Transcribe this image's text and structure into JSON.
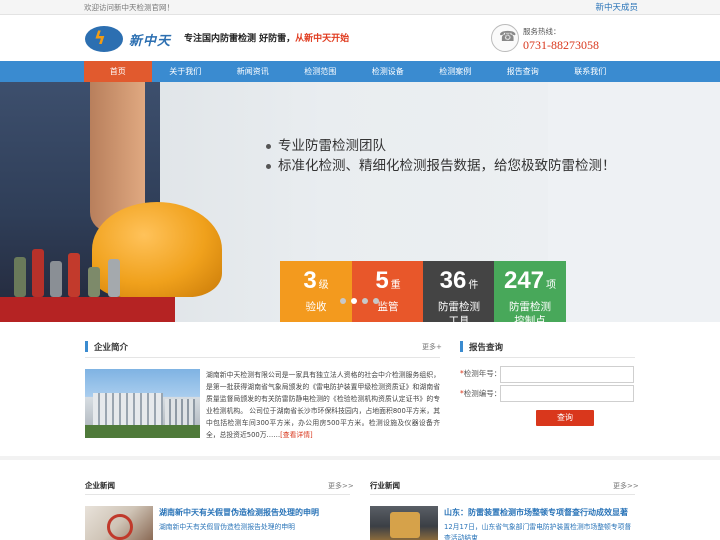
{
  "topbar": {
    "welcome": "欢迎访问新中天检测官网！",
    "member": "新中天成员"
  },
  "header": {
    "logo_text": "新中天",
    "slogan_main": "专注国内防雷检测 好防雷，",
    "slogan_red": "从新中天开始",
    "hotline_label": "服务热线：",
    "hotline_number": "0731-88273058"
  },
  "nav": {
    "items": [
      "首页",
      "关于我们",
      "新闻资讯",
      "检测范围",
      "检测设备",
      "检测案例",
      "报告查询",
      "联系我们"
    ],
    "active_index": 0
  },
  "banner": {
    "bullets": [
      "专业防雷检测团队",
      "标准化检测、精细化检测报告数据，给您极致防雷检测！"
    ],
    "stats": [
      {
        "number": "3",
        "unit": "级",
        "desc1": "验收",
        "desc2": "",
        "color": "#f39a1e"
      },
      {
        "number": "5",
        "unit": "重",
        "desc1": "监管",
        "desc2": "",
        "color": "#e8572a"
      },
      {
        "number": "36",
        "unit": "件",
        "desc1": "防雷检测",
        "desc2": "工具",
        "color": "#444444"
      },
      {
        "number": "247",
        "unit": "项",
        "desc1": "防雷检测",
        "desc2": "控制点",
        "color": "#48a85a"
      }
    ],
    "slide_count": 4,
    "active_slide": 1
  },
  "company": {
    "title": "企业简介",
    "more": "更多+",
    "text": "湖南新中天检测有限公司是一家具有独立法人资格的社会中介检测服务组织，是第一批获得湖南省气象局颁发的《雷电防护装置甲级检测资质证》和湖南省质量监督局颁发的有关防雷防静电检测的《检验检测机构资质认定证书》的专业检测机构。 公司位于湖南省长沙市环保科技园内，占地面积800平方米，其中包括检测车间300平方米，办公用房500平方米。检测设施及仪器设备齐全，总投资近500万……",
    "detail_link": "[查看详情]"
  },
  "report": {
    "title": "报告查询",
    "fields": [
      {
        "label": "检测年号：",
        "value": "",
        "placeholder": ""
      },
      {
        "label": "检测编号：",
        "value": "",
        "placeholder": ""
      }
    ],
    "button": "查询"
  },
  "company_news": {
    "title": "企业新闻",
    "more": "更多>>",
    "headline": "湖南新中天有关假冒伪造检测报告处理的申明",
    "summary": "湖南新中天有关假冒伪造检测报告处理的申明"
  },
  "industry_news": {
    "title": "行业新闻",
    "more": "更多>>",
    "headline": "山东：防雷装置检测市场整顿专项督查行动成效显著",
    "summary": "12月17日，山东省气象部门雷电防护装置检测市场整顿专项督查活动结束"
  }
}
